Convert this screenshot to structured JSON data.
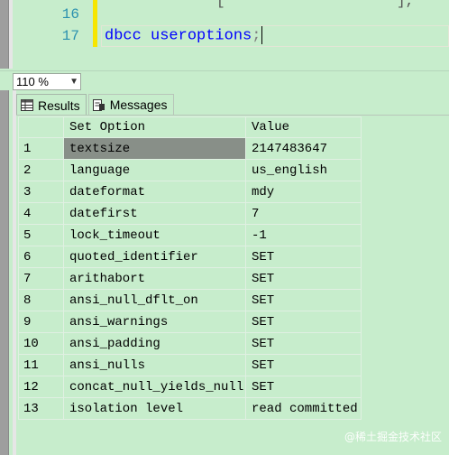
{
  "editor": {
    "lines": [
      {
        "number": "16",
        "code": ""
      },
      {
        "number": "17",
        "keyword": "dbcc",
        "rest": " useroptions",
        "punct": ";"
      }
    ],
    "top_fragment_left": "[",
    "top_fragment_right": "],"
  },
  "zoom": {
    "value": "110 %"
  },
  "tabs": [
    {
      "label": "Results",
      "icon": "grid-icon"
    },
    {
      "label": "Messages",
      "icon": "message-icon"
    }
  ],
  "grid": {
    "columns": [
      "Set Option",
      "Value"
    ],
    "rows": [
      {
        "n": "1",
        "option": "textsize",
        "value": "2147483647"
      },
      {
        "n": "2",
        "option": "language",
        "value": "us_english"
      },
      {
        "n": "3",
        "option": "dateformat",
        "value": "mdy"
      },
      {
        "n": "4",
        "option": "datefirst",
        "value": "7"
      },
      {
        "n": "5",
        "option": "lock_timeout",
        "value": "-1"
      },
      {
        "n": "6",
        "option": "quoted_identifier",
        "value": "SET"
      },
      {
        "n": "7",
        "option": "arithabort",
        "value": "SET"
      },
      {
        "n": "8",
        "option": "ansi_null_dflt_on",
        "value": "SET"
      },
      {
        "n": "9",
        "option": "ansi_warnings",
        "value": "SET"
      },
      {
        "n": "10",
        "option": "ansi_padding",
        "value": "SET"
      },
      {
        "n": "11",
        "option": "ansi_nulls",
        "value": "SET"
      },
      {
        "n": "12",
        "option": "concat_null_yields_null",
        "value": "SET"
      },
      {
        "n": "13",
        "option": "isolation level",
        "value": "read committed"
      }
    ]
  },
  "watermark": "@稀土掘金技术社区",
  "colors": {
    "background": "#c7edcc",
    "keyword": "#0000ff",
    "line_number": "#2b91af",
    "selected_cell": "#888f88"
  }
}
